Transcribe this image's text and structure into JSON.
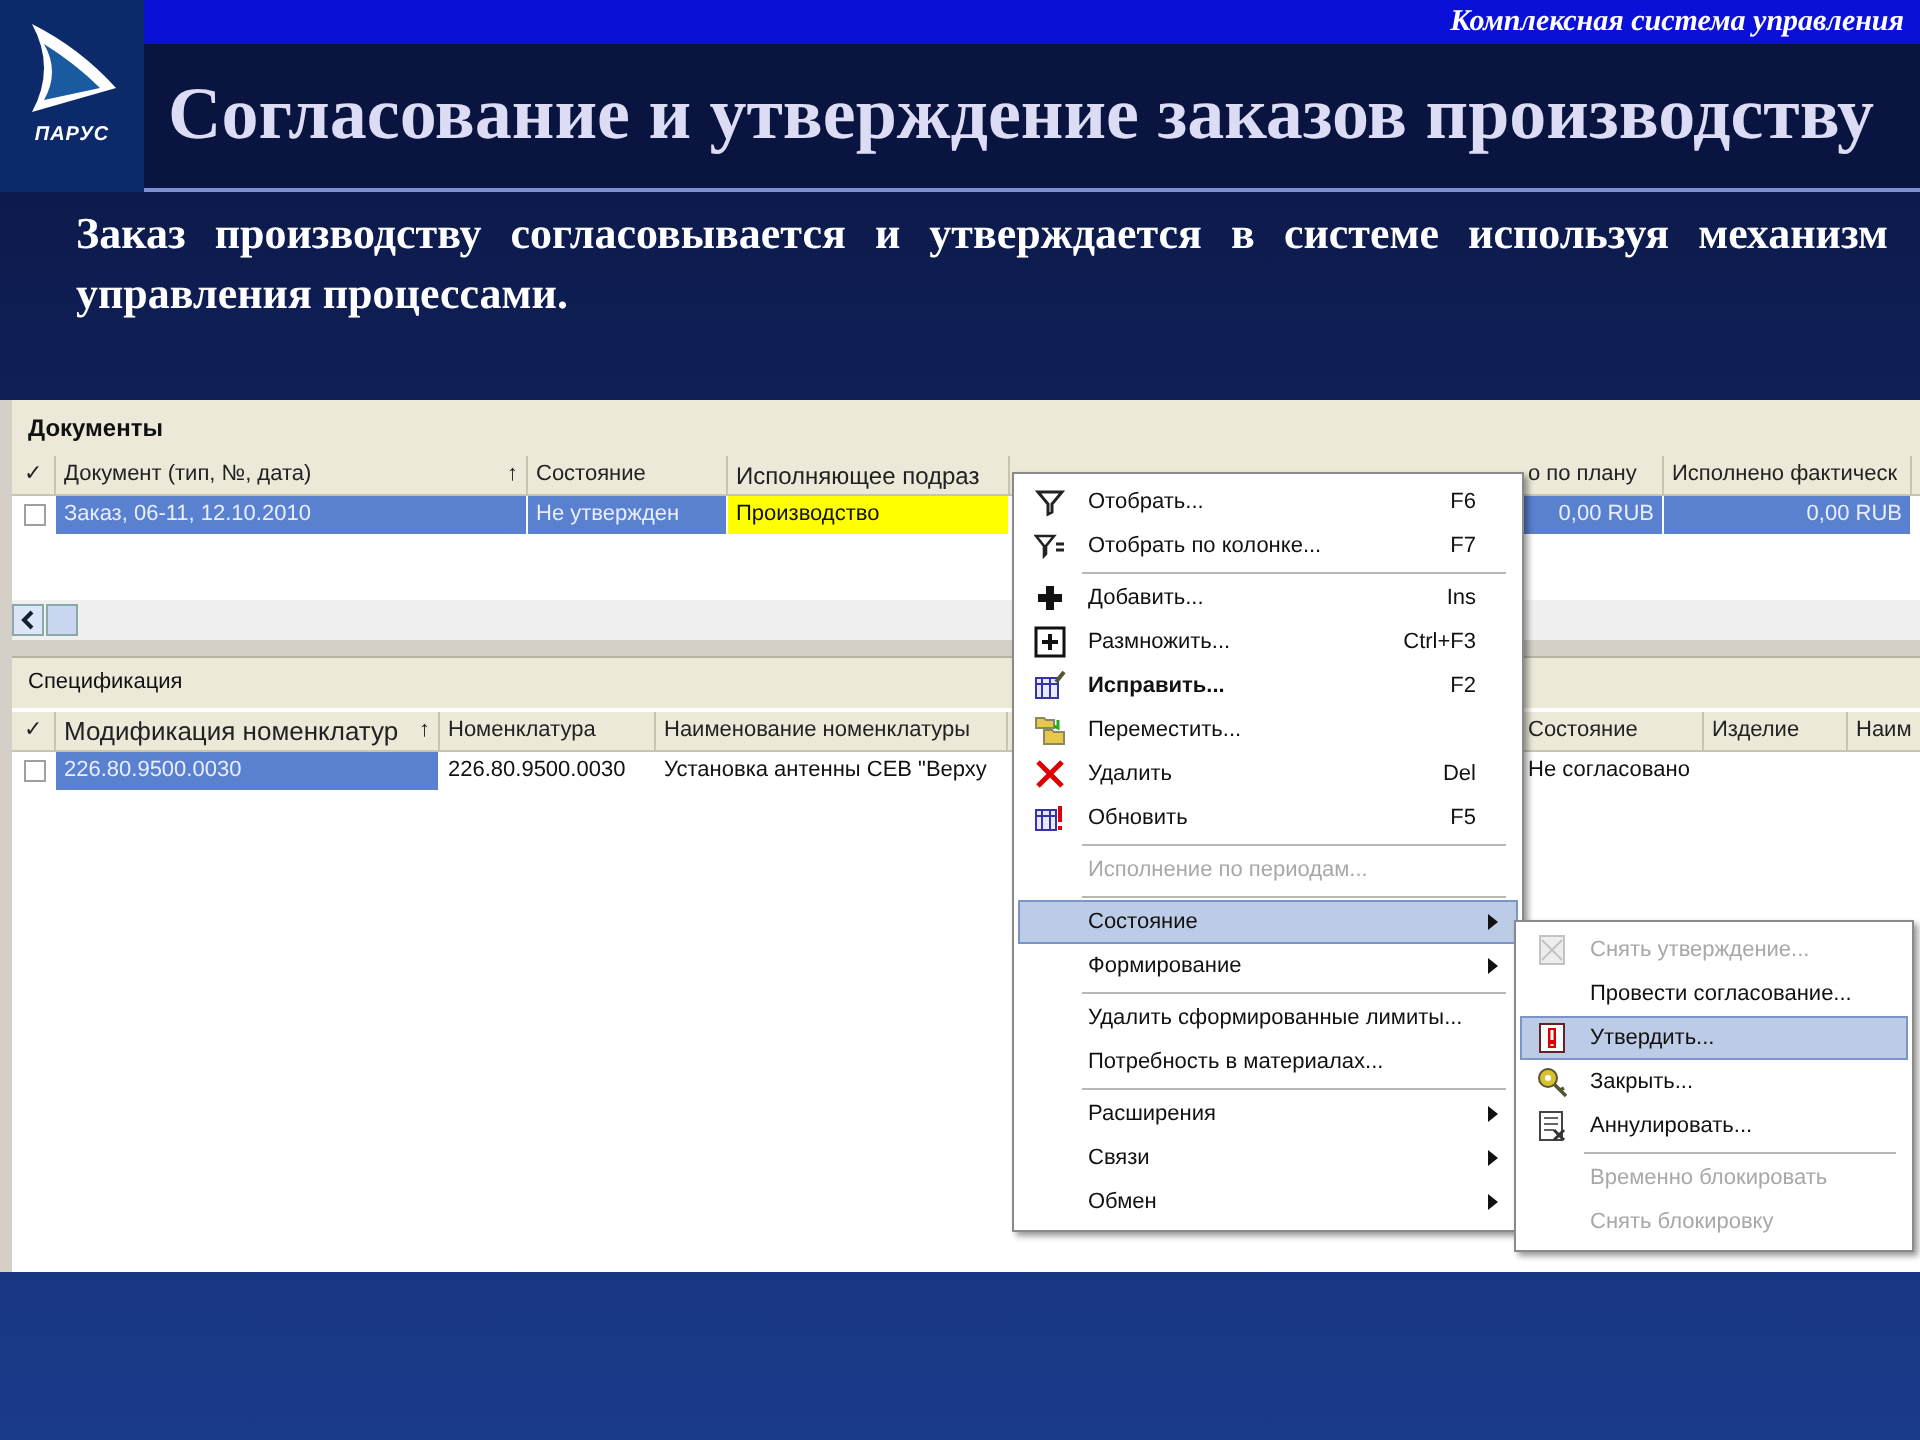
{
  "slide": {
    "logo_text": "ПАРУС",
    "tagline": "Комплексная система управления",
    "title": "Согласование и утверждение заказов производству",
    "subtitle": "Заказ производству согласовывается и утверждается в системе используя механизм управления процессами."
  },
  "documents": {
    "title": "Документы",
    "check_header": "✓",
    "columns": [
      "Документ (тип, №, дата)",
      "Состояние",
      "Исполняющее подраз",
      "о по плану",
      "Исполнено фактическ"
    ],
    "sort_mark": "↑",
    "rows": [
      {
        "checked": false,
        "cells": [
          {
            "text": "Заказ, 06-11, 12.10.2010",
            "selected": true
          },
          {
            "text": "Не утвержден",
            "selected": true
          },
          {
            "text": "Производство",
            "selected": false,
            "color": "#ffff00"
          },
          {
            "text": "0,00 RUB",
            "selected": true
          },
          {
            "text": "0,00 RUB",
            "selected": true
          }
        ]
      }
    ]
  },
  "specification": {
    "title": "Спецификация",
    "check_header": "✓",
    "columns": [
      "Модификация номенклатур",
      "Номенклатура",
      "Наименование номенклатуры",
      "Состояние",
      "Изделие",
      "Наим"
    ],
    "sort_mark": "↑",
    "rows": [
      {
        "checked": false,
        "cells": [
          {
            "text": "226.80.9500.0030",
            "selected": true
          },
          {
            "text": "226.80.9500.0030",
            "selected": false
          },
          {
            "text": "Установка антенны СЕВ \"Верху",
            "selected": false
          },
          {
            "text": "Не согласовано",
            "selected": false
          }
        ]
      }
    ]
  },
  "context_menu": [
    {
      "kind": "item",
      "label": "Отобрать...",
      "shortcut": "F6",
      "bold": false,
      "disabled": false,
      "selected": false,
      "submenu": false
    },
    {
      "kind": "item",
      "label": "Отобрать по колонке...",
      "shortcut": "F7",
      "bold": false,
      "disabled": false,
      "selected": false,
      "submenu": false
    },
    {
      "kind": "separator"
    },
    {
      "kind": "item",
      "label": "Добавить...",
      "shortcut": "Ins",
      "bold": false,
      "disabled": false,
      "selected": false,
      "submenu": false
    },
    {
      "kind": "item",
      "label": "Размножить...",
      "shortcut": "Ctrl+F3",
      "bold": false,
      "disabled": false,
      "selected": false,
      "submenu": false
    },
    {
      "kind": "item",
      "label": "Исправить...",
      "shortcut": "F2",
      "bold": true,
      "disabled": false,
      "selected": false,
      "submenu": false
    },
    {
      "kind": "item",
      "label": "Переместить...",
      "bold": false,
      "disabled": false,
      "selected": false,
      "submenu": false
    },
    {
      "kind": "item",
      "label": "Удалить",
      "shortcut": "Del",
      "bold": false,
      "disabled": false,
      "selected": false,
      "submenu": false
    },
    {
      "kind": "item",
      "label": "Обновить",
      "shortcut": "F5",
      "bold": false,
      "disabled": false,
      "selected": false,
      "submenu": false
    },
    {
      "kind": "separator"
    },
    {
      "kind": "item",
      "label": "Исполнение по периодам...",
      "bold": false,
      "disabled": true,
      "selected": false,
      "submenu": false
    },
    {
      "kind": "separator"
    },
    {
      "kind": "item",
      "label": "Состояние",
      "bold": false,
      "disabled": false,
      "selected": true,
      "submenu": true
    },
    {
      "kind": "item",
      "label": "Формирование",
      "bold": false,
      "disabled": false,
      "selected": false,
      "submenu": true
    },
    {
      "kind": "separator"
    },
    {
      "kind": "item",
      "label": "Удалить сформированные лимиты...",
      "bold": false,
      "disabled": false,
      "selected": false,
      "submenu": false
    },
    {
      "kind": "item",
      "label": "Потребность в материалах...",
      "bold": false,
      "disabled": false,
      "selected": false,
      "submenu": false
    },
    {
      "kind": "separator"
    },
    {
      "kind": "item",
      "label": "Расширения",
      "bold": false,
      "disabled": false,
      "selected": false,
      "submenu": true
    },
    {
      "kind": "item",
      "label": "Связи",
      "bold": false,
      "disabled": false,
      "selected": false,
      "submenu": true
    },
    {
      "kind": "item",
      "label": "Обмен",
      "bold": false,
      "disabled": false,
      "selected": false,
      "submenu": true
    }
  ],
  "submenu": [
    {
      "kind": "item",
      "label": "Снять утверждение...",
      "disabled": true,
      "selected": false
    },
    {
      "kind": "item",
      "label": "Провести согласование...",
      "disabled": false,
      "selected": false
    },
    {
      "kind": "item",
      "label": "Утвердить...",
      "disabled": false,
      "selected": true
    },
    {
      "kind": "item",
      "label": "Закрыть...",
      "disabled": false,
      "selected": false
    },
    {
      "kind": "item",
      "label": "Аннулировать...",
      "disabled": false,
      "selected": false
    },
    {
      "kind": "separator"
    },
    {
      "kind": "item",
      "label": "Временно блокировать",
      "disabled": true,
      "selected": false
    },
    {
      "kind": "item",
      "label": "Снять блокировку",
      "disabled": true,
      "selected": false
    }
  ]
}
